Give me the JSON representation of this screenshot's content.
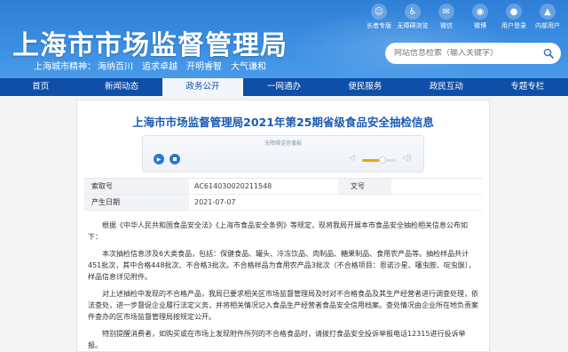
{
  "header": {
    "title": "上海市市场监督管理局",
    "spirit": {
      "lead": "上海城市精神：",
      "items": [
        "海纳百川",
        "追求卓越",
        "开明睿智",
        "大气谦和"
      ]
    },
    "search_placeholder": "网站信息检索（输入关键字）",
    "top_icons": [
      {
        "label": "长者专版",
        "icon": "elder-icon",
        "glyph": "☺"
      },
      {
        "label": "无障碍浏览",
        "icon": "accessibility-icon",
        "glyph": "♿"
      },
      {
        "label": "微信",
        "icon": "wechat-icon",
        "glyph": "✉"
      },
      {
        "label": "微博",
        "icon": "weibo-icon",
        "glyph": "◉"
      },
      {
        "label": "用户登录",
        "icon": "user-icon",
        "glyph": "●"
      },
      {
        "label": "内部用户",
        "icon": "internal-user-icon",
        "glyph": "▲"
      }
    ]
  },
  "nav": {
    "items": [
      "首页",
      "新闻动态",
      "政务公开",
      "一网通办",
      "便民服务",
      "政民互动",
      "专题专栏"
    ],
    "active_index": 2
  },
  "article": {
    "title": "上海市市场监督管理局2021年第25期省级食品安全抽检信息",
    "audio_label": "无障碍语音播报",
    "volume_level": 0.6,
    "meta": {
      "index_label": "索取号",
      "index_value": "AC614030020211548",
      "text_label": "文号",
      "text_value": "",
      "date_label": "产生日期",
      "date_value": "2021-07-07"
    },
    "paragraphs": [
      "根据《中华人民共和国食品安全法》《上海市食品安全条例》等规定，现将我局开展本市食品安全抽检相关信息公布如下：",
      "本次抽检信息涉及6大类食品，包括：保健食品、罐头、冷冻饮品、肉制品、糖果制品、食用农产品等。抽检样品共计451批次，其中合格448批次、不合格3批次。不合格样品为食用农产品3批次（不合格项目：恩诺沙星、噻虫胺、啶虫脒），样品信息详见附件。",
      "对上述抽检中发现的不合格产品，我局已要求相关区市场监督管理局及时对不合格食品及其生产经营者进行调查处理，依法查处，进一步督促企业履行法定义务，并将相关情况记入食品生产经营者食品安全信用档案。查处情况由企业所在地负责案件查办的区市场监督管理局按规定公开。",
      "特别提醒消费者，如购买或在市场上发现附件所列的不合格食品时，请拨打食品安全投诉举报电话12315进行投诉举报。"
    ]
  },
  "colors": {
    "header_blue": "#3b8fe3",
    "nav_blue": "#0f4fa8",
    "title_blue": "#1a5bb5",
    "volume_orange": "#f0a020"
  }
}
